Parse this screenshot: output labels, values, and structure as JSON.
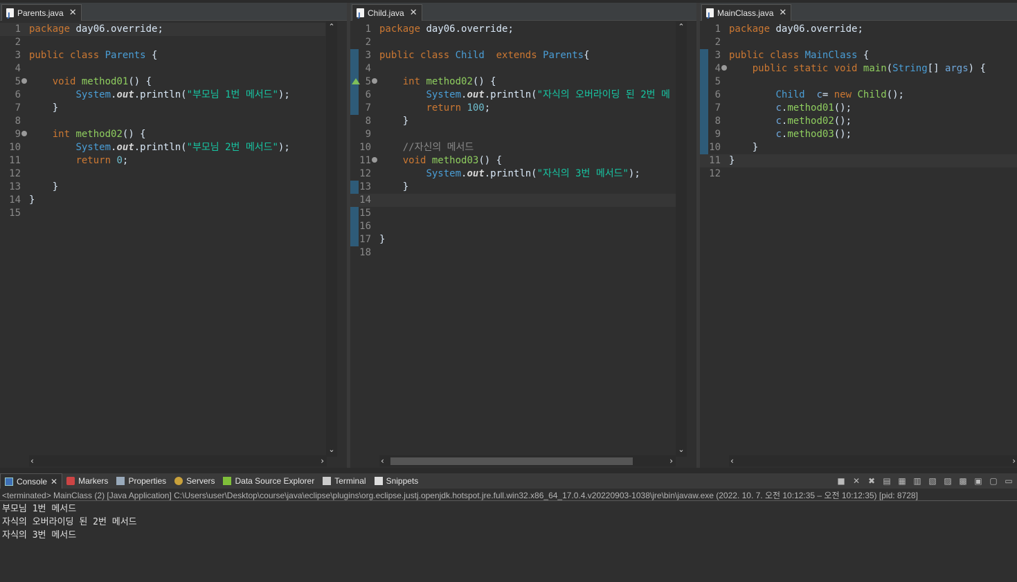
{
  "editors": [
    {
      "tab": "Parents.java",
      "lines": [
        {
          "n": "1",
          "html": "<span class=\"kw\">package</span> day06.override;"
        },
        {
          "n": "2",
          "html": ""
        },
        {
          "n": "3",
          "html": "<span class=\"kw\">public</span> <span class=\"kw\">class</span> <span class=\"tp\">Parents</span> {"
        },
        {
          "n": "4",
          "html": ""
        },
        {
          "n": "5",
          "html": "    <span class=\"kw\">void</span> <span class=\"fn\">method01</span>() {"
        },
        {
          "n": "6",
          "html": "        <span class=\"sys\">System</span>.<span class=\"fld\">out</span>.println(<span class=\"str\">\"부모님 1번 메서드\"</span>);"
        },
        {
          "n": "7",
          "html": "    }"
        },
        {
          "n": "8",
          "html": ""
        },
        {
          "n": "9",
          "html": "    <span class=\"kw\">int</span> <span class=\"fn\">method02</span>() {"
        },
        {
          "n": "10",
          "html": "        <span class=\"sys\">System</span>.<span class=\"fld\">out</span>.println(<span class=\"str\">\"부모님 2번 메서드\"</span>);"
        },
        {
          "n": "11",
          "html": "        <span class=\"kw\">return</span> <span class=\"num\">0</span>;"
        },
        {
          "n": "12",
          "html": ""
        },
        {
          "n": "13",
          "html": "    }"
        },
        {
          "n": "14",
          "html": "}"
        },
        {
          "n": "15",
          "html": ""
        }
      ]
    },
    {
      "tab": "Child.java",
      "lines": [
        {
          "n": "1",
          "html": "<span class=\"kw\">package</span> day06.override;"
        },
        {
          "n": "2",
          "html": ""
        },
        {
          "n": "3",
          "html": "<span class=\"kw\">public</span> <span class=\"kw\">class</span> <span class=\"tp\">Child</span>  <span class=\"kw\">extends</span> <span class=\"tp\">Parents</span>{"
        },
        {
          "n": "4",
          "html": ""
        },
        {
          "n": "5",
          "html": "    <span class=\"kw\">int</span> <span class=\"fn\">method02</span>() {"
        },
        {
          "n": "6",
          "html": "        <span class=\"sys\">System</span>.<span class=\"fld\">out</span>.println(<span class=\"str\">\"자식의 오버라이딩 된 2번 메</span>"
        },
        {
          "n": "7",
          "html": "        <span class=\"kw\">return</span> <span class=\"num\">100</span>;"
        },
        {
          "n": "8",
          "html": "    }"
        },
        {
          "n": "9",
          "html": ""
        },
        {
          "n": "10",
          "html": "    <span class=\"cmt\">//자신의 메서드</span>"
        },
        {
          "n": "11",
          "html": "    <span class=\"kw\">void</span> <span class=\"fn\">method03</span>() {"
        },
        {
          "n": "12",
          "html": "        <span class=\"sys\">System</span>.<span class=\"fld\">out</span>.println(<span class=\"str\">\"자식의 3번 메서드\"</span>);"
        },
        {
          "n": "13",
          "html": "    }"
        },
        {
          "n": "14",
          "html": ""
        },
        {
          "n": "15",
          "html": ""
        },
        {
          "n": "16",
          "html": ""
        },
        {
          "n": "17",
          "html": "}"
        },
        {
          "n": "18",
          "html": ""
        }
      ]
    },
    {
      "tab": "MainClass.java",
      "lines": [
        {
          "n": "1",
          "html": "<span class=\"kw\">package</span> day06.override;"
        },
        {
          "n": "2",
          "html": ""
        },
        {
          "n": "3",
          "html": "<span class=\"kw\">public</span> <span class=\"kw\">class</span> <span class=\"tp\">MainClass</span> {"
        },
        {
          "n": "4",
          "html": "    <span class=\"kw\">public</span> <span class=\"kw\">static</span> <span class=\"kw\">void</span> <span class=\"fn\">main</span>(<span class=\"tp\">String</span>[] <span class=\"var\">args</span>) {"
        },
        {
          "n": "5",
          "html": ""
        },
        {
          "n": "6",
          "html": "        <span class=\"tp\">Child</span>  <span class=\"var\">c</span>= <span class=\"kw\">new</span> <span class=\"fn\">Child</span>();"
        },
        {
          "n": "7",
          "html": "        <span class=\"var\">c</span>.<span class=\"fn\">method01</span>();"
        },
        {
          "n": "8",
          "html": "        <span class=\"var\">c</span>.<span class=\"fn\">method02</span>();"
        },
        {
          "n": "9",
          "html": "        <span class=\"var\">c</span>.<span class=\"fn\">method03</span>();"
        },
        {
          "n": "10",
          "html": "    }"
        },
        {
          "n": "11",
          "html": "}"
        },
        {
          "n": "12",
          "html": ""
        }
      ]
    }
  ],
  "console": {
    "tabs": [
      "Console",
      "Markers",
      "Properties",
      "Servers",
      "Data Source Explorer",
      "Terminal",
      "Snippets"
    ],
    "status": "<terminated> MainClass (2) [Java Application] C:\\Users\\user\\Desktop\\course\\java\\eclipse\\plugins\\org.eclipse.justj.openjdk.hotspot.jre.full.win32.x86_64_17.0.4.v20220903-1038\\jre\\bin\\javaw.exe  (2022. 10. 7. 오전 10:12:35 – 오전 10:12:35) [pid: 8728]",
    "output": [
      "부모님 1번 메서드",
      "자식의 오버라이딩 된 2번 메서드",
      "자식의 3번 메서드"
    ]
  }
}
